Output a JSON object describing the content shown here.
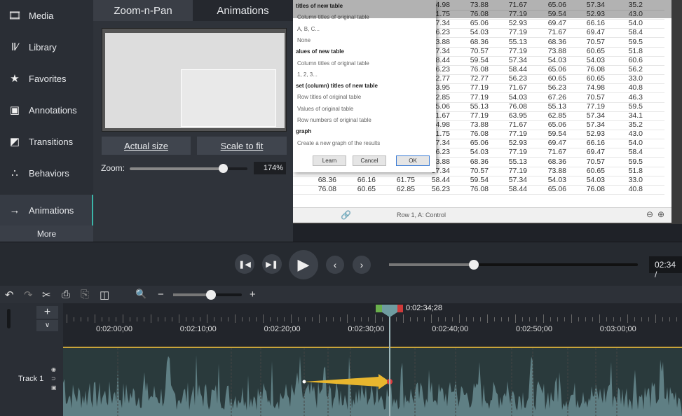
{
  "sidebar": {
    "items": [
      {
        "label": "Media",
        "icon": "media-icon"
      },
      {
        "label": "Library",
        "icon": "library-icon"
      },
      {
        "label": "Favorites",
        "icon": "star-icon"
      },
      {
        "label": "Annotations",
        "icon": "annotations-icon"
      },
      {
        "label": "Transitions",
        "icon": "transitions-icon"
      },
      {
        "label": "Behaviors",
        "icon": "behaviors-icon"
      },
      {
        "label": "Animations",
        "icon": "animations-icon",
        "active": true
      }
    ],
    "more": "More"
  },
  "panel": {
    "tabs": [
      {
        "label": "Zoom-n-Pan",
        "active": true
      },
      {
        "label": "Animations"
      }
    ],
    "actual_size": "Actual size",
    "scale_to_fit": "Scale to fit",
    "zoom_label": "Zoom:",
    "zoom_value": "174%",
    "zoom_fraction": 0.8
  },
  "canvas": {
    "dialog": {
      "lines": [
        {
          "t": "titles of new table",
          "b": true
        },
        {
          "t": "Column titles of original table"
        },
        {
          "t": "A, B, C..."
        },
        {
          "t": "None"
        },
        {
          "t": "alues of new table",
          "b": true
        },
        {
          "t": "Column titles of original table"
        },
        {
          "t": "1, 2, 3..."
        },
        {
          "t": "set (column) titles of new table",
          "b": true
        },
        {
          "t": "Row titles of original table"
        },
        {
          "t": "Values of original table"
        },
        {
          "t": "Row numbers of original table"
        },
        {
          "t": "graph",
          "b": true
        },
        {
          "t": "Create a new graph of the results"
        }
      ],
      "learn": "Learn",
      "cancel": "Cancel",
      "ok": "OK"
    },
    "left_rows": [
      [
        "68.36",
        "66.16",
        "61.75"
      ],
      [
        "76.08",
        "60.65",
        "62.85"
      ]
    ],
    "rows": [
      [
        "74.98",
        "73.88",
        "71.67",
        "65.06",
        "57.34",
        "35.2"
      ],
      [
        "61.75",
        "76.08",
        "77.19",
        "59.54",
        "52.93",
        "43.0"
      ],
      [
        "57.34",
        "65.06",
        "52.93",
        "69.47",
        "66.16",
        "54.0"
      ],
      [
        "56.23",
        "54.03",
        "77.19",
        "71.67",
        "69.47",
        "58.4"
      ],
      [
        "73.88",
        "68.36",
        "55.13",
        "68.36",
        "70.57",
        "59.5"
      ],
      [
        "57.34",
        "70.57",
        "77.19",
        "73.88",
        "60.65",
        "51.8"
      ],
      [
        "58.44",
        "59.54",
        "57.34",
        "54.03",
        "54.03",
        "60.6"
      ],
      [
        "56.23",
        "76.08",
        "58.44",
        "65.06",
        "76.08",
        "56.2"
      ],
      [
        "72.77",
        "72.77",
        "56.23",
        "60.65",
        "60.65",
        "33.0"
      ],
      [
        "63.95",
        "77.19",
        "71.67",
        "56.23",
        "74.98",
        "40.8"
      ],
      [
        "62.85",
        "77.19",
        "54.03",
        "67.26",
        "70.57",
        "46.3"
      ],
      [
        "65.06",
        "55.13",
        "76.08",
        "55.13",
        "77.19",
        "59.5"
      ],
      [
        "71.67",
        "77.19",
        "63.95",
        "62.85",
        "57.34",
        "34.1"
      ],
      [
        "74.98",
        "73.88",
        "71.67",
        "65.06",
        "57.34",
        "35.2"
      ],
      [
        "61.75",
        "76.08",
        "77.19",
        "59.54",
        "52.93",
        "43.0"
      ],
      [
        "57.34",
        "65.06",
        "52.93",
        "69.47",
        "66.16",
        "54.0"
      ],
      [
        "56.23",
        "54.03",
        "77.19",
        "71.67",
        "69.47",
        "58.4"
      ],
      [
        "73.88",
        "68.36",
        "55.13",
        "68.36",
        "70.57",
        "59.5"
      ],
      [
        "57.34",
        "70.57",
        "77.19",
        "73.88",
        "60.65",
        "51.8"
      ],
      [
        "58.44",
        "59.54",
        "57.34",
        "54.03",
        "54.03",
        "33.0"
      ],
      [
        "56.23",
        "76.08",
        "58.44",
        "65.06",
        "76.08",
        "40.8"
      ]
    ],
    "status": "Row 1, A: Control"
  },
  "player": {
    "time": "02:34 /",
    "progress": 0.34
  },
  "timeline": {
    "playhead_time": "0:02:34;28",
    "ticks": [
      "0:02:00;00",
      "0:02:10;00",
      "0:02:20;00",
      "0:02:30;00",
      "0:02:40;00",
      "0:02:50;00",
      "0:03:00;00"
    ],
    "track_name": "Track 1",
    "zoom_fraction": 0.55,
    "colors": {
      "accent": "#3bb5a8",
      "track_line": "#c9a43a",
      "arrow": "#e8b62e"
    }
  }
}
